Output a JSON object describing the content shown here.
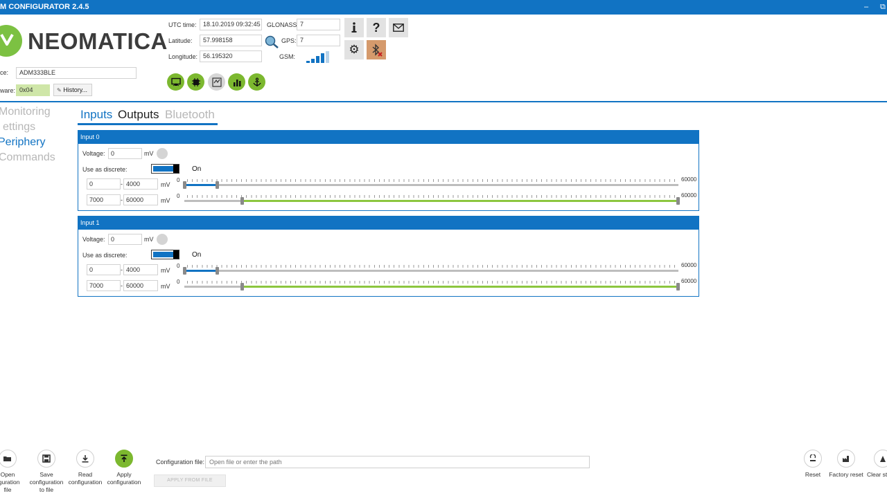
{
  "app": {
    "title": "M CONFIGURATOR 2.4.5",
    "minimize_glyph": "–",
    "restore_glyph": "⧉"
  },
  "logo": {
    "wordmark": "NEOMATICA",
    "brand_color": "#7cc142"
  },
  "device": {
    "label": "ce:",
    "value": "ADM333BLE",
    "firmware_label": "ware:",
    "firmware_value": "0x04",
    "history_label": "History..."
  },
  "gps": {
    "utc_label": "UTC time:",
    "utc_value": "18.10.2019 09:32:45",
    "lat_label": "Latitude:",
    "lat_value": "57.998158",
    "lon_label": "Longitude:",
    "lon_value": "56.195320",
    "glonass_label": "GLONASS:",
    "glonass_value": "7",
    "gps_label": "GPS:",
    "gps_value": "7",
    "gsm_label": "GSM:",
    "gsm_bars": 4
  },
  "toolbar_icons": [
    "info-icon",
    "help-icon",
    "mail-icon",
    "settings-icon",
    "bluetooth-disconnected-icon"
  ],
  "action_icons": [
    "monitor-icon",
    "chip-icon",
    "compare-icon",
    "analytics-icon",
    "anchor-icon"
  ],
  "nav": [
    "Monitoring",
    "Settings",
    "Periphery",
    "Commands"
  ],
  "nav_display": [
    "Monitoring",
    "ettings",
    "Periphery",
    "Commands"
  ],
  "nav_active": "Periphery",
  "tabs": [
    "Inputs",
    "Outputs",
    "Bluetooth"
  ],
  "active_tab": "Inputs",
  "inputs": [
    {
      "title": "Input 0",
      "voltage_label": "Voltage:",
      "voltage": "0",
      "unit": "mV",
      "discrete_label": "Use as discrete:",
      "discrete_state": "On",
      "ranges": [
        {
          "min": "0",
          "max": "4000",
          "unit": "mV",
          "scale_min": "0",
          "scale_max": "60000",
          "low": 0,
          "high": 4000
        },
        {
          "min": "7000",
          "max": "60000",
          "unit": "mV",
          "scale_min": "0",
          "scale_max": "60000",
          "low": 7000,
          "high": 60000
        }
      ]
    },
    {
      "title": "Input 1",
      "voltage_label": "Voltage:",
      "voltage": "0",
      "unit": "mV",
      "discrete_label": "Use as discrete:",
      "discrete_state": "On",
      "ranges": [
        {
          "min": "0",
          "max": "4000",
          "unit": "mV",
          "scale_min": "0",
          "scale_max": "60000",
          "low": 0,
          "high": 4000
        },
        {
          "min": "7000",
          "max": "60000",
          "unit": "mV",
          "scale_min": "0",
          "scale_max": "60000",
          "low": 7000,
          "high": 60000
        }
      ]
    }
  ],
  "bottom": {
    "open": "Open\nfiguration\nfile",
    "save": "Save\nconfiguration\nto file",
    "read": "Read\nconfiguration",
    "apply": "Apply\nconfiguration",
    "config_file_label": "Configuration file:",
    "config_file_placeholder": "Open file or enter the path",
    "apply_from_file": "APPLY FROM FILE",
    "reset": "Reset",
    "factory_reset": "Factory reset",
    "clear": "Clear st"
  },
  "colors": {
    "accent": "#1173c3",
    "green": "#7cb82f",
    "range_low": "#1173c3",
    "range_high": "#8cc63f"
  }
}
